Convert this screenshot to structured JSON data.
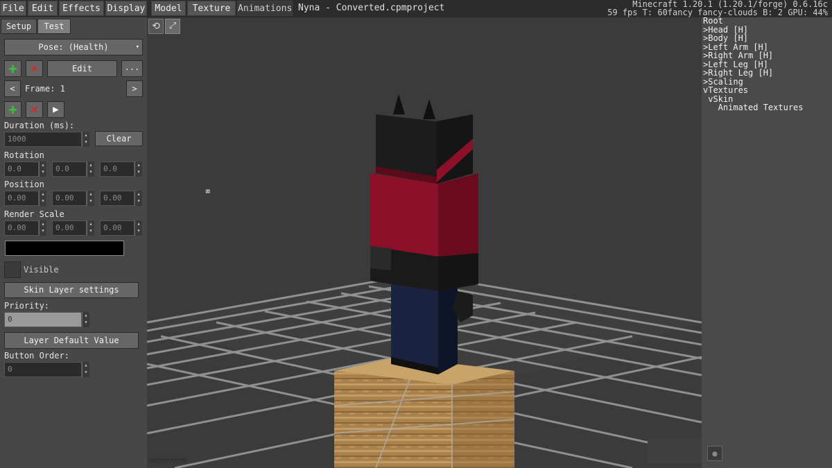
{
  "menu": [
    "File",
    "Edit",
    "Effects",
    "Display",
    "Model",
    "Texture",
    "Animations"
  ],
  "document_title": "Nyna - Converted.cpmproject",
  "mc_info": {
    "version": "Minecraft 1.20.1 (1.20.1/forge) 0.6.16c",
    "perf": "59 fps T: 60fancy fancy-clouds B: 2 GPU: 44%"
  },
  "left_tabs": [
    "Setup",
    "Test"
  ],
  "pose": "Pose: (Health)",
  "edit_label": "Edit",
  "more_label": "...",
  "frame_label": "Frame: 1",
  "duration": {
    "label": "Duration (ms):",
    "value": "1000",
    "clear": "Clear"
  },
  "rotation": {
    "label": "Rotation",
    "values": [
      "0.0",
      "0.0",
      "0.0"
    ]
  },
  "position": {
    "label": "Position",
    "values": [
      "0.00",
      "0.00",
      "0.00"
    ]
  },
  "render_scale": {
    "label": "Render Scale",
    "values": [
      "0.00",
      "0.00",
      "0.00"
    ]
  },
  "color_swatch": "#000000",
  "visible_label": "Visible",
  "skin_layer_settings": "Skin Layer settings",
  "priority": {
    "label": "Priority:",
    "value": "0"
  },
  "layer_default_value": "Layer Default Value",
  "button_order": {
    "label": "Button Order:",
    "value": "0"
  },
  "tree": [
    {
      "text": ">Head [H]"
    },
    {
      "text": ">Body [H]"
    },
    {
      "text": ">Left Arm [H]"
    },
    {
      "text": ">Right Arm [H]"
    },
    {
      "text": ">Left Leg [H]"
    },
    {
      "text": ">Right Leg [H]"
    },
    {
      "text": ">Scaling"
    },
    {
      "text": "vTextures"
    },
    {
      "text": " vSkin"
    },
    {
      "text": "   Animated Textures"
    }
  ],
  "tree_root": "Root",
  "colors": {
    "panel": "#474747",
    "viewport": "#3b3b3b",
    "hoodie_red": "#8b1028",
    "pants_blue": "#1a2440",
    "head_black": "#1c1c1c",
    "wood": "#b08a55"
  }
}
